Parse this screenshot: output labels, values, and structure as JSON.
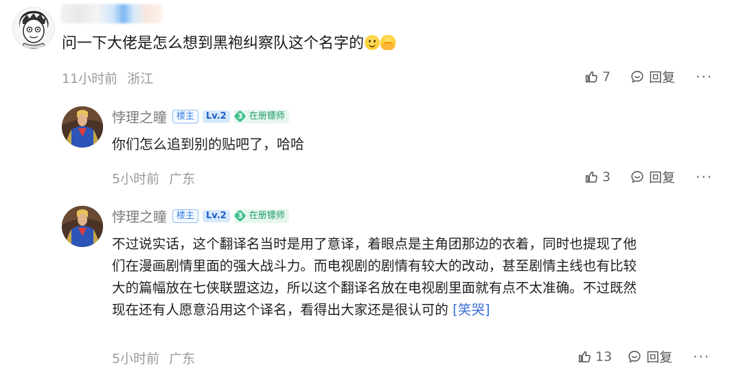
{
  "top_comment": {
    "username": "",
    "text": "问一下大佬是怎么想到黑袍纠察队这个名字的",
    "emojis": [
      "smile-emoji",
      "hands-emoji"
    ],
    "time": "11小时前",
    "location": "浙江",
    "like_count": "7",
    "reply_label": "回复",
    "more_label": "···"
  },
  "replies": [
    {
      "username": "悖理之瞳",
      "badge_owner": "楼主",
      "badge_level": "Lv.2",
      "badge_role_num": "3",
      "badge_role": "在册镖师",
      "text": "你们怎么追到别的贴吧了，哈哈",
      "time": "5小时前",
      "location": "广东",
      "like_count": "3",
      "reply_label": "回复",
      "more_label": "···"
    },
    {
      "username": "悖理之瞳",
      "badge_owner": "楼主",
      "badge_level": "Lv.2",
      "badge_role_num": "3",
      "badge_role": "在册镖师",
      "text_lines": [
        "不过说实话，这个翻译名当时是用了意译，着眼点是主角团那边的衣着，同时也提现了他",
        "们在漫画剧情里面的强大战斗力。而电视剧的剧情有较大的改动，甚至剧情主线也有比较",
        "大的篇幅放在七侠联盟这边，所以这个翻译名放在电视剧里面就有点不太准确。不过既然",
        "现在还有人愿意沿用这个译名，看得出大家还是很认可的 "
      ],
      "text_emoticon": "[笑哭]",
      "time": "5小时前",
      "location": "广东",
      "like_count": "13",
      "reply_label": "回复",
      "more_label": "···"
    }
  ],
  "colors": {
    "meta_text": "#9a9a9a",
    "owner_badge": "#3a84e8",
    "level_badge": "#1d5fc7",
    "role_badge": "#1f9b67",
    "emoticon_link": "#3a6fd8"
  }
}
